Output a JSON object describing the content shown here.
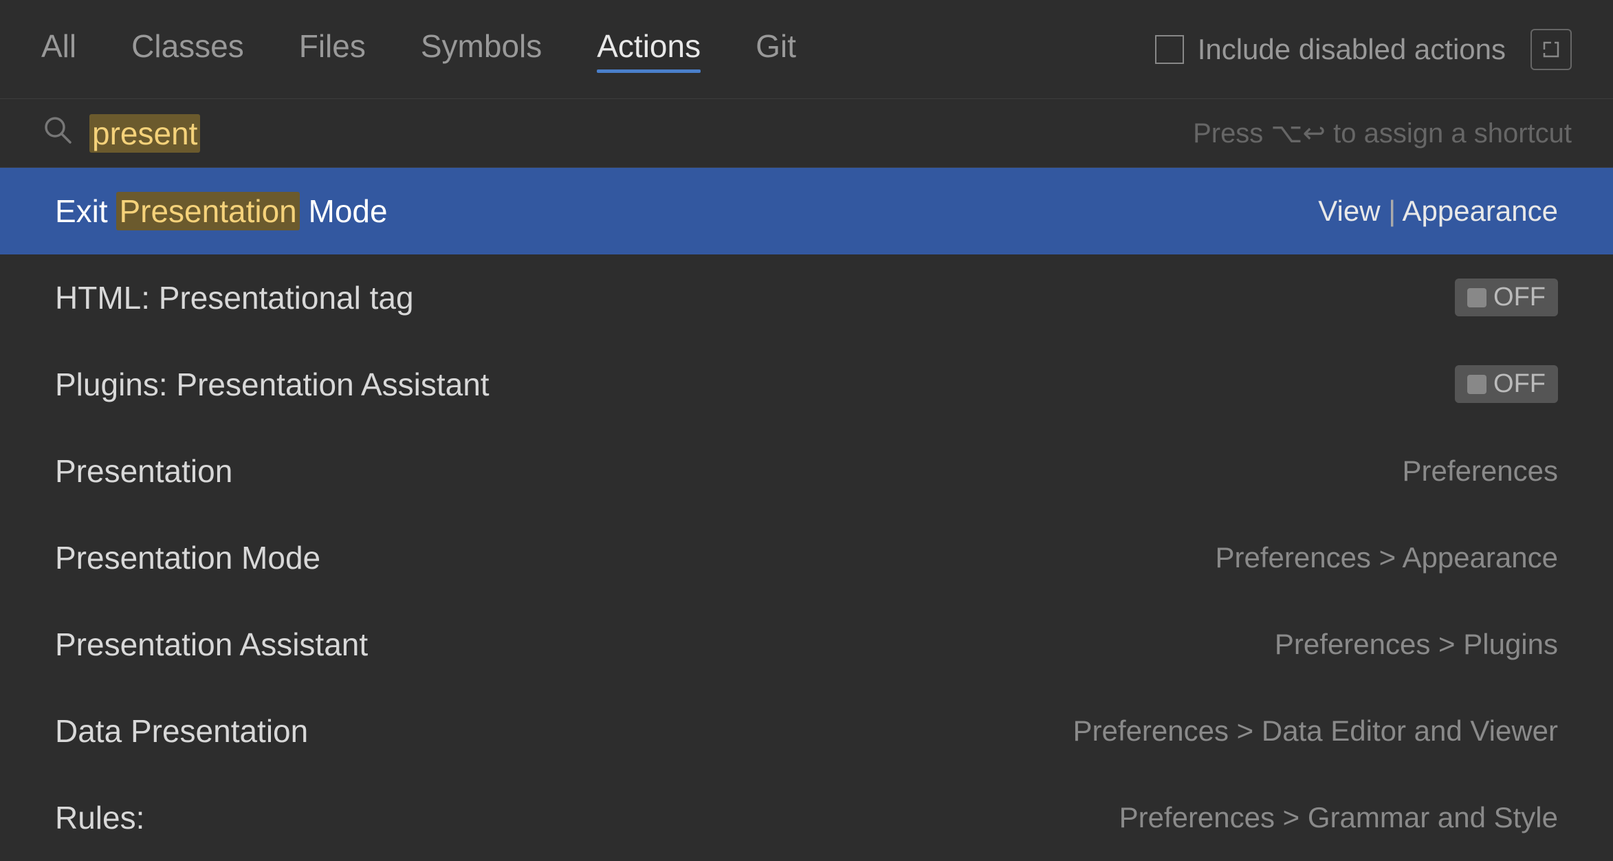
{
  "tabs": [
    {
      "id": "all",
      "label": "All",
      "active": false
    },
    {
      "id": "classes",
      "label": "Classes",
      "active": false
    },
    {
      "id": "files",
      "label": "Files",
      "active": false
    },
    {
      "id": "symbols",
      "label": "Symbols",
      "active": false
    },
    {
      "id": "actions",
      "label": "Actions",
      "active": true
    },
    {
      "id": "git",
      "label": "Git",
      "active": false
    }
  ],
  "include_disabled": {
    "label": "Include disabled actions"
  },
  "search": {
    "query": "present",
    "hint": "Press ⌥↩ to assign a shortcut"
  },
  "results": [
    {
      "id": "exit-presentation-mode",
      "name_prefix": "Exit ",
      "name_highlight": "Presentation",
      "name_suffix": " Mode",
      "meta": "View | Appearance",
      "meta_type": "path",
      "selected": true
    },
    {
      "id": "html-presentational-tag",
      "name_prefix": "HTML: Presentational tag",
      "name_highlight": "",
      "name_suffix": "",
      "meta": "OFF",
      "meta_type": "toggle",
      "selected": false
    },
    {
      "id": "plugins-presentation-assistant",
      "name_prefix": "Plugins: Presentation Assistant",
      "name_highlight": "",
      "name_suffix": "",
      "meta": "OFF",
      "meta_type": "toggle",
      "selected": false
    },
    {
      "id": "presentation",
      "name_prefix": "Presentation",
      "name_highlight": "",
      "name_suffix": "",
      "meta": "Preferences",
      "meta_type": "text",
      "selected": false
    },
    {
      "id": "presentation-mode",
      "name_prefix": "Presentation Mode",
      "name_highlight": "",
      "name_suffix": "",
      "meta": "Preferences > Appearance",
      "meta_type": "text",
      "selected": false
    },
    {
      "id": "presentation-assistant",
      "name_prefix": "Presentation Assistant",
      "name_highlight": "",
      "name_suffix": "",
      "meta": "Preferences > Plugins",
      "meta_type": "text",
      "selected": false
    },
    {
      "id": "data-presentation",
      "name_prefix": "Data Presentation",
      "name_highlight": "",
      "name_suffix": "",
      "meta": "Preferences > Data Editor and Viewer",
      "meta_type": "text",
      "selected": false
    },
    {
      "id": "rules",
      "name_prefix": "Rules:",
      "name_highlight": "",
      "name_suffix": "",
      "meta": "Preferences > Grammar and Style",
      "meta_type": "text",
      "selected": false
    }
  ]
}
